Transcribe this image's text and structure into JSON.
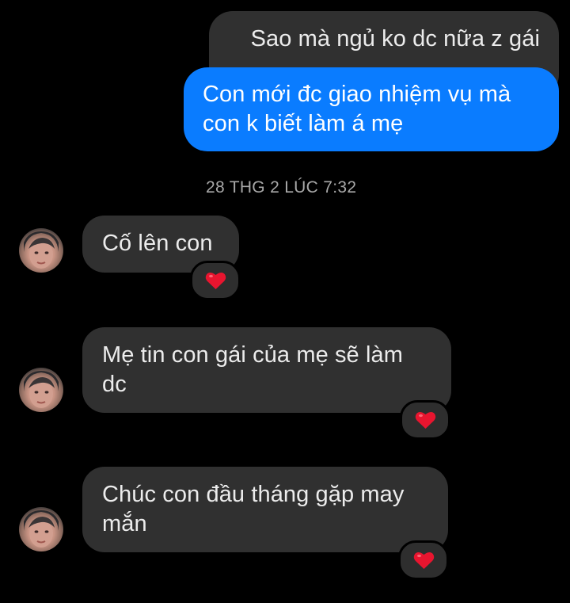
{
  "thread": {
    "outgoing": [
      {
        "text": "Sao mà ngủ ko dc nữa z gái"
      },
      {
        "text": "Con mới đc giao nhiệm vụ mà\ncon k biết làm á mẹ"
      }
    ],
    "timestamp": "28 THG 2 LÚC 7:32",
    "incoming": [
      {
        "text": "Cố lên con",
        "reaction": "heart-icon"
      },
      {
        "text": "Mẹ tin con gái của mẹ sẽ làm\ndc",
        "reaction": "heart-icon"
      },
      {
        "text": "Chúc con đầu tháng gặp may\nmắn",
        "reaction": "heart-icon"
      }
    ]
  },
  "colors": {
    "background": "#000000",
    "incoming_bubble": "#303030",
    "outgoing_gray_bubble": "#303030",
    "outgoing_blue_bubble": "#0a7cff",
    "text": "#ececec",
    "timestamp": "#a8a8a8",
    "heart": "#e8152f"
  }
}
